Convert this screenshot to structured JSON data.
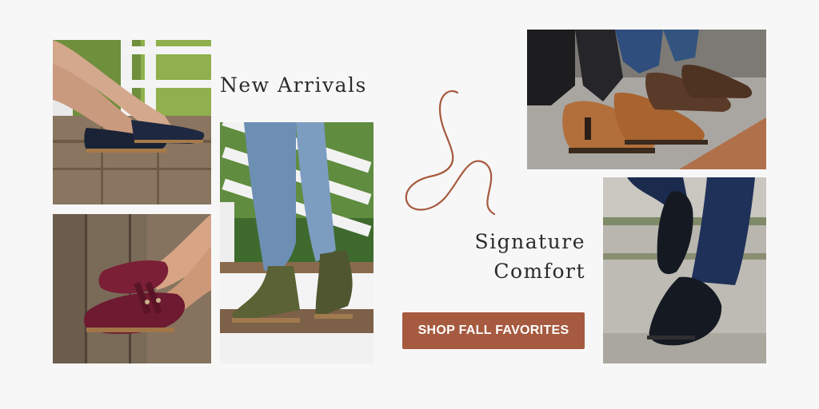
{
  "headline_primary": "New Arrivals",
  "ampersand": "&",
  "headline_secondary": [
    "Signature",
    "Comfort"
  ],
  "cta_label": "SHOP FALL FAVORITES",
  "colors": {
    "background": "#f7f7f7",
    "accent": "#a65a3f",
    "text": "#2b2b2b"
  }
}
